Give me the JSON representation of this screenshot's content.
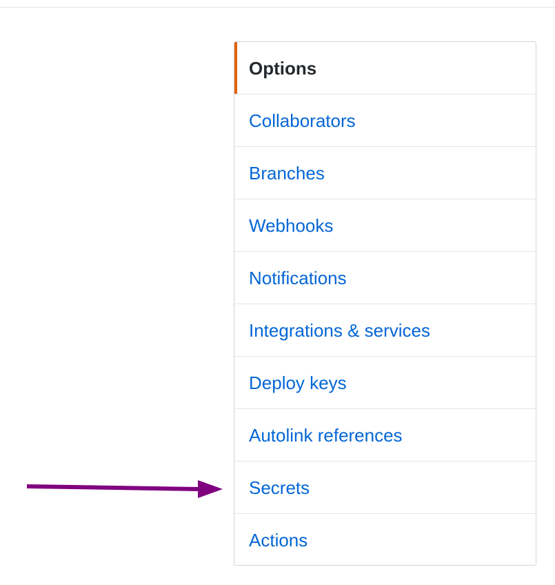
{
  "menu": {
    "items": [
      {
        "label": "Options",
        "selected": true
      },
      {
        "label": "Collaborators"
      },
      {
        "label": "Branches"
      },
      {
        "label": "Webhooks"
      },
      {
        "label": "Notifications"
      },
      {
        "label": "Integrations & services"
      },
      {
        "label": "Deploy keys"
      },
      {
        "label": "Autolink references"
      },
      {
        "label": "Secrets"
      },
      {
        "label": "Actions"
      }
    ]
  },
  "annotation": {
    "arrow_target": "Secrets",
    "arrow_color": "#800080"
  },
  "colors": {
    "link": "#0366d6",
    "selected_text": "#24292e",
    "selected_accent": "#e36209",
    "border": "#d1d5da"
  }
}
